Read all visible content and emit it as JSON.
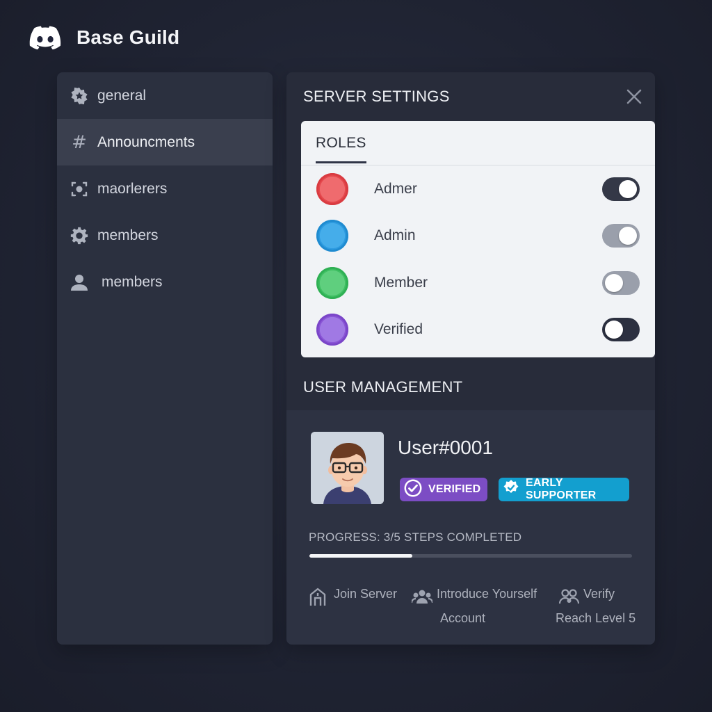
{
  "app": {
    "title": "Base Guild",
    "logo_icon": "discord-logo"
  },
  "sidebar": {
    "channels": [
      {
        "label": "general",
        "icon": "star-gear-icon"
      },
      {
        "label": "Announcments",
        "icon": "hash-icon",
        "active": true
      },
      {
        "label": "maorlerers",
        "icon": "target-icon"
      },
      {
        "label": "members",
        "icon": "gear-icon"
      },
      {
        "label": "members",
        "icon": "user-icon"
      }
    ]
  },
  "panel": {
    "title": "SERVER SETTINGS",
    "roles": {
      "tab": "ROLES",
      "items": [
        {
          "name": "Admer",
          "color": "#e5484d",
          "enabled": true
        },
        {
          "name": "Admin",
          "color": "#2d9be0",
          "enabled": true
        },
        {
          "name": "Member",
          "color": "#3fbf63",
          "enabled": false
        },
        {
          "name": "Verified",
          "color": "#8a55d6",
          "enabled": false
        }
      ]
    },
    "user_management": {
      "title": "USER MANAGEMENT",
      "username": "User#0001",
      "badges": {
        "verified": "VERIFIED",
        "early": "EARLY SUPPORTER"
      },
      "progress": {
        "label": "PROGRESS: 3/5 STEPS COMPLETED",
        "completed": 3,
        "total": 5,
        "fraction": 0.32
      },
      "steps": {
        "join": "Join Server",
        "introduce": "Introduce Yourself",
        "account": "Account",
        "verify": "Verify",
        "level": "Reach Level 5"
      }
    }
  },
  "colors": {
    "accent_verified": "#7c4dc4",
    "accent_early": "#139fcf"
  }
}
